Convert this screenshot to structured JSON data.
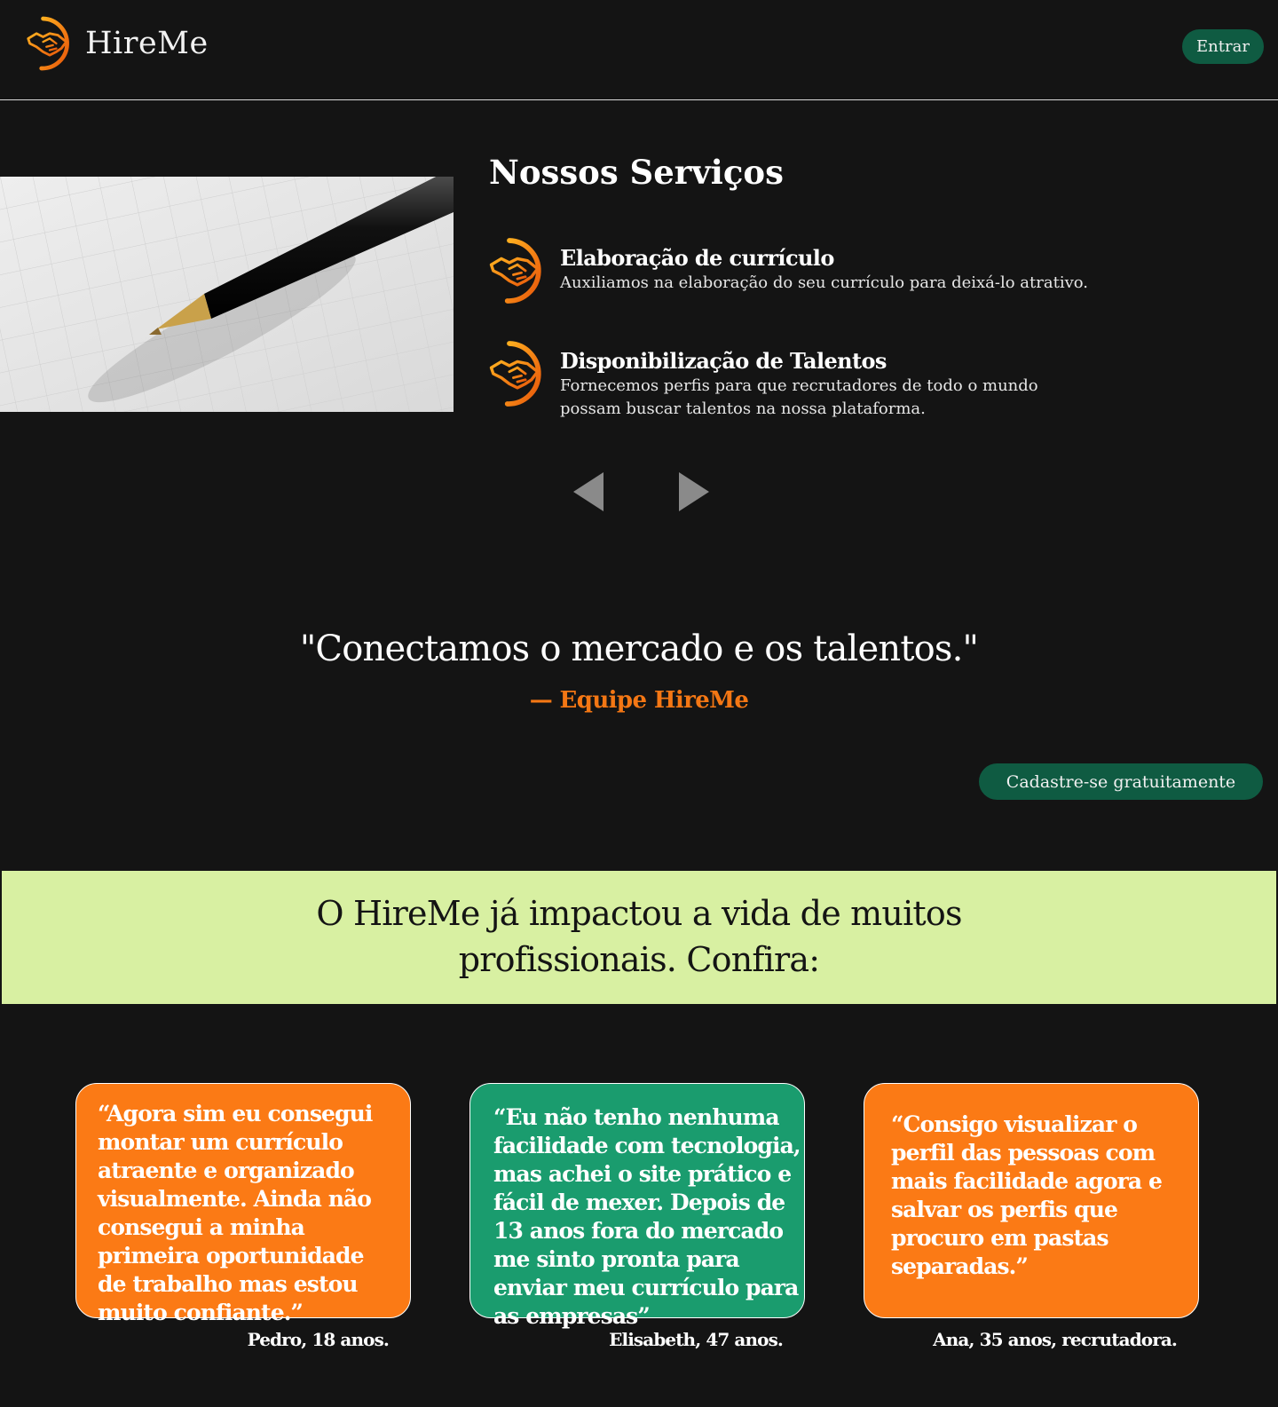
{
  "header": {
    "brand": "HireMe",
    "login_label": "Entrar"
  },
  "services": {
    "title": "Nossos Serviços",
    "items": [
      {
        "title": "Elaboração de currículo",
        "description": "Auxiliamos na elaboração do seu currículo para deixá-lo atrativo."
      },
      {
        "title": "Disponibilização de Talentos",
        "description": "Fornecemos perfis para que recrutadores de todo o mundo possam buscar talentos na nossa plataforma."
      }
    ],
    "image": "pen-on-grid-paper",
    "icon": "handshake-icon"
  },
  "quote": {
    "text": "\"Conectamos o mercado e os talentos.\"",
    "author": "— Equipe HireMe"
  },
  "signup_label": "Cadastre-se gratuitamente",
  "impact": {
    "line1": "O HireMe já impactou a vida de muitos",
    "line2": "profissionais. Confira:"
  },
  "testimonials": [
    {
      "text": "“Agora sim eu consegui montar um currículo atraente e organizado visualmente. Ainda não consegui a minha primeira oportunidade de trabalho mas estou muito confiante.”",
      "author": "Pedro, 18 anos."
    },
    {
      "text": "“Eu não tenho nenhuma facilidade com tecnologia, mas achei o site prático e fácil de mexer. Depois de 13 anos fora do mercado me sinto pronta para enviar meu currículo para as empresas”",
      "author": "Elisabeth, 47 anos."
    },
    {
      "text": "“Consigo visualizar o perfil das pessoas com mais facilidade agora e salvar os perfis que procuro em pastas separadas.”",
      "author": "Ana, 35 anos, recrutadora."
    }
  ],
  "colors": {
    "background": "#141414",
    "accent_orange": "#fb7a15",
    "accent_green": "#0f5b42",
    "card_green": "#1a9c6e",
    "banner": "#d8f0a2"
  }
}
